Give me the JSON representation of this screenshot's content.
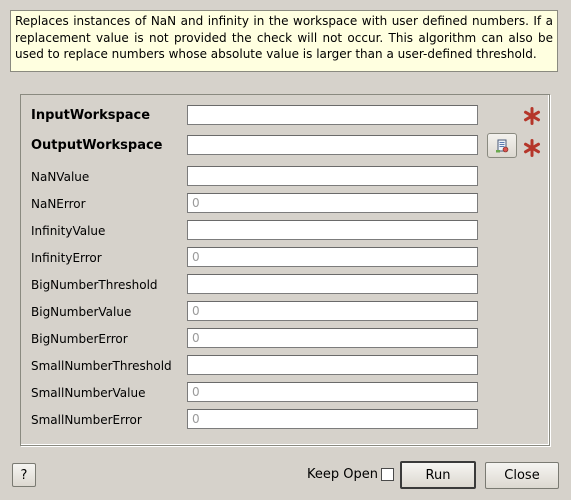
{
  "description": "Replaces instances of NaN and infinity in the workspace with user defined numbers. If a replacement value is not provided the check will not occur. This algorithm can also be used to replace numbers whose absolute value is larger than a user-defined threshold.",
  "properties": [
    {
      "label": "InputWorkspace",
      "value": "",
      "placeholder": "",
      "required": true
    },
    {
      "label": "OutputWorkspace",
      "value": "",
      "placeholder": "",
      "required": true,
      "browse": true
    },
    {
      "label": "NaNValue",
      "value": "",
      "placeholder": ""
    },
    {
      "label": "NaNError",
      "value": "",
      "placeholder": "0"
    },
    {
      "label": "InfinityValue",
      "value": "",
      "placeholder": ""
    },
    {
      "label": "InfinityError",
      "value": "",
      "placeholder": "0"
    },
    {
      "label": "BigNumberThreshold",
      "value": "",
      "placeholder": ""
    },
    {
      "label": "BigNumberValue",
      "value": "",
      "placeholder": "0"
    },
    {
      "label": "BigNumberError",
      "value": "",
      "placeholder": "0"
    },
    {
      "label": "SmallNumberThreshold",
      "value": "",
      "placeholder": ""
    },
    {
      "label": "SmallNumberValue",
      "value": "",
      "placeholder": "0"
    },
    {
      "label": "SmallNumberError",
      "value": "",
      "placeholder": "0"
    }
  ],
  "footer": {
    "help_label": "?",
    "keep_open_label": "Keep Open",
    "keep_open_checked": false,
    "run_label": "Run",
    "close_label": "Close"
  },
  "colors": {
    "required_star": "#b5362a",
    "description_bg": "#ffffe0",
    "window_bg": "#d6d2cb"
  },
  "icons": {
    "browse": "workspace-browse-icon",
    "required": "required-star-icon"
  }
}
